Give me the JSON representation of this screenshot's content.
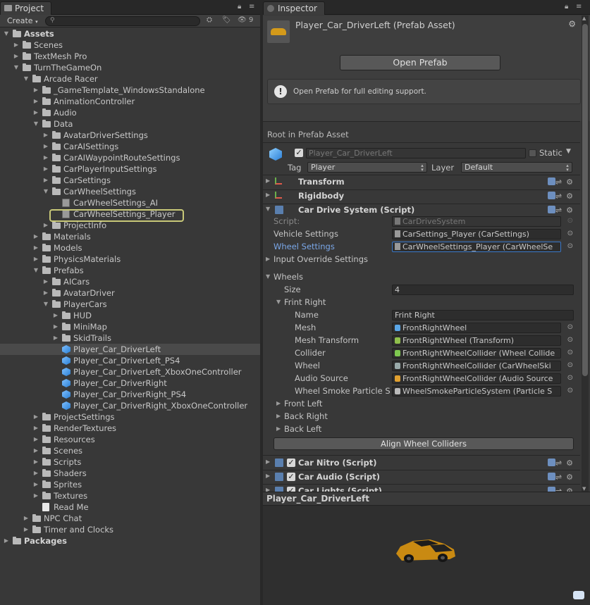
{
  "project": {
    "tab_label": "Project",
    "create_label": "Create",
    "hidden_count": "9",
    "tree": [
      {
        "label": "Assets",
        "depth": 0,
        "arrow": "open",
        "icon": "folder",
        "bold": true
      },
      {
        "label": "Scenes",
        "depth": 1,
        "arrow": "closed",
        "icon": "folder"
      },
      {
        "label": "TextMesh Pro",
        "depth": 1,
        "arrow": "closed",
        "icon": "folder"
      },
      {
        "label": "TurnTheGameOn",
        "depth": 1,
        "arrow": "open",
        "icon": "folder"
      },
      {
        "label": "Arcade Racer",
        "depth": 2,
        "arrow": "open",
        "icon": "folder"
      },
      {
        "label": "_GameTemplate_WindowsStandalone",
        "depth": 3,
        "arrow": "closed",
        "icon": "folder"
      },
      {
        "label": "AnimationController",
        "depth": 3,
        "arrow": "closed",
        "icon": "folder"
      },
      {
        "label": "Audio",
        "depth": 3,
        "arrow": "closed",
        "icon": "folder"
      },
      {
        "label": "Data",
        "depth": 3,
        "arrow": "open",
        "icon": "folder"
      },
      {
        "label": "AvatarDriverSettings",
        "depth": 4,
        "arrow": "closed",
        "icon": "folder"
      },
      {
        "label": "CarAISettings",
        "depth": 4,
        "arrow": "closed",
        "icon": "folder"
      },
      {
        "label": "CarAIWaypointRouteSettings",
        "depth": 4,
        "arrow": "closed",
        "icon": "folder"
      },
      {
        "label": "CarPlayerInputSettings",
        "depth": 4,
        "arrow": "closed",
        "icon": "folder"
      },
      {
        "label": "CarSettings",
        "depth": 4,
        "arrow": "closed",
        "icon": "folder"
      },
      {
        "label": "CarWheelSettings",
        "depth": 4,
        "arrow": "open",
        "icon": "folder"
      },
      {
        "label": "CarWheelSettings_AI",
        "depth": 5,
        "arrow": "none",
        "icon": "asset"
      },
      {
        "label": "CarWheelSettings_Player",
        "depth": 5,
        "arrow": "none",
        "icon": "asset",
        "highlight": true
      },
      {
        "label": "ProjectInfo",
        "depth": 4,
        "arrow": "closed",
        "icon": "folder"
      },
      {
        "label": "Materials",
        "depth": 3,
        "arrow": "closed",
        "icon": "folder"
      },
      {
        "label": "Models",
        "depth": 3,
        "arrow": "closed",
        "icon": "folder"
      },
      {
        "label": "PhysicsMaterials",
        "depth": 3,
        "arrow": "closed",
        "icon": "folder"
      },
      {
        "label": "Prefabs",
        "depth": 3,
        "arrow": "open",
        "icon": "folder"
      },
      {
        "label": "AICars",
        "depth": 4,
        "arrow": "closed",
        "icon": "folder"
      },
      {
        "label": "AvatarDriver",
        "depth": 4,
        "arrow": "closed",
        "icon": "folder"
      },
      {
        "label": "PlayerCars",
        "depth": 4,
        "arrow": "open",
        "icon": "folder"
      },
      {
        "label": "HUD",
        "depth": 5,
        "arrow": "closed",
        "icon": "folder"
      },
      {
        "label": "MiniMap",
        "depth": 5,
        "arrow": "closed",
        "icon": "folder"
      },
      {
        "label": "SkidTrails",
        "depth": 5,
        "arrow": "closed",
        "icon": "folder"
      },
      {
        "label": "Player_Car_DriverLeft",
        "depth": 5,
        "arrow": "none",
        "icon": "prefab",
        "selected": true
      },
      {
        "label": "Player_Car_DriverLeft_PS4",
        "depth": 5,
        "arrow": "none",
        "icon": "prefab"
      },
      {
        "label": "Player_Car_DriverLeft_XboxOneController",
        "depth": 5,
        "arrow": "none",
        "icon": "prefab"
      },
      {
        "label": "Player_Car_DriverRight",
        "depth": 5,
        "arrow": "none",
        "icon": "prefab"
      },
      {
        "label": "Player_Car_DriverRight_PS4",
        "depth": 5,
        "arrow": "none",
        "icon": "prefab"
      },
      {
        "label": "Player_Car_DriverRight_XboxOneController",
        "depth": 5,
        "arrow": "none",
        "icon": "prefab"
      },
      {
        "label": "ProjectSettings",
        "depth": 3,
        "arrow": "closed",
        "icon": "folder"
      },
      {
        "label": "RenderTextures",
        "depth": 3,
        "arrow": "closed",
        "icon": "folder"
      },
      {
        "label": "Resources",
        "depth": 3,
        "arrow": "closed",
        "icon": "folder"
      },
      {
        "label": "Scenes",
        "depth": 3,
        "arrow": "closed",
        "icon": "folder"
      },
      {
        "label": "Scripts",
        "depth": 3,
        "arrow": "closed",
        "icon": "folder"
      },
      {
        "label": "Shaders",
        "depth": 3,
        "arrow": "closed",
        "icon": "folder"
      },
      {
        "label": "Sprites",
        "depth": 3,
        "arrow": "closed",
        "icon": "folder"
      },
      {
        "label": "Textures",
        "depth": 3,
        "arrow": "closed",
        "icon": "folder"
      },
      {
        "label": "Read Me",
        "depth": 3,
        "arrow": "none",
        "icon": "doc"
      },
      {
        "label": "NPC Chat",
        "depth": 2,
        "arrow": "closed",
        "icon": "folder"
      },
      {
        "label": "Timer and Clocks",
        "depth": 2,
        "arrow": "closed",
        "icon": "folder"
      },
      {
        "label": "Packages",
        "depth": 0,
        "arrow": "closed",
        "icon": "folder",
        "bold": true
      }
    ]
  },
  "inspector": {
    "tab_label": "Inspector",
    "asset_title": "Player_Car_DriverLeft (Prefab Asset)",
    "open_prefab_label": "Open Prefab",
    "help_text": "Open Prefab for full editing support.",
    "root_label": "Root in Prefab Asset",
    "object_name": "Player_Car_DriverLeft",
    "static_label": "Static",
    "tag_label": "Tag",
    "tag_value": "Player",
    "layer_label": "Layer",
    "layer_value": "Default",
    "components": {
      "transform": "Transform",
      "rigidbody": "Rigidbody",
      "car_drive": "Car Drive System (Script)",
      "car_nitro": "Car Nitro (Script)",
      "car_audio": "Car Audio (Script)",
      "car_lights": "Car Lights (Script)"
    },
    "drive": {
      "script_label": "Script:",
      "script_value": "CarDriveSystem",
      "vehicle_settings_label": "Vehicle Settings",
      "vehicle_settings_value": "CarSettings_Player (CarSettings)",
      "wheel_settings_label": "Wheel Settings",
      "wheel_settings_value": "CarWheelSettings_Player (CarWheelSe",
      "input_override_label": "Input Override Settings",
      "wheels_label": "Wheels",
      "size_label": "Size",
      "size_value": "4",
      "front_right_label": "Frint Right",
      "fields": [
        {
          "label": "Name",
          "value": "Frint Right",
          "icon": "none"
        },
        {
          "label": "Mesh",
          "value": "FrontRightWheel",
          "icon": "mesh"
        },
        {
          "label": "Mesh Transform",
          "value": "FrontRightWheel (Transform)",
          "icon": "transform"
        },
        {
          "label": "Collider",
          "value": "FrontRightWheelCollider (Wheel Collide",
          "icon": "collider"
        },
        {
          "label": "Wheel",
          "value": "FrontRightWheelCollider (CarWheelSki",
          "icon": "script"
        },
        {
          "label": "Audio Source",
          "value": "FrontRightWheelCollider (Audio Source",
          "icon": "audio"
        },
        {
          "label": "Wheel Smoke Particle S",
          "value": "WheelSmokeParticleSystem (Particle S",
          "icon": "particle"
        }
      ],
      "front_left_label": "Front Left",
      "back_right_label": "Back Right",
      "back_left_label": "Back Left",
      "align_button_label": "Align Wheel Colliders"
    },
    "preview_title": "Player_Car_DriverLeft"
  }
}
